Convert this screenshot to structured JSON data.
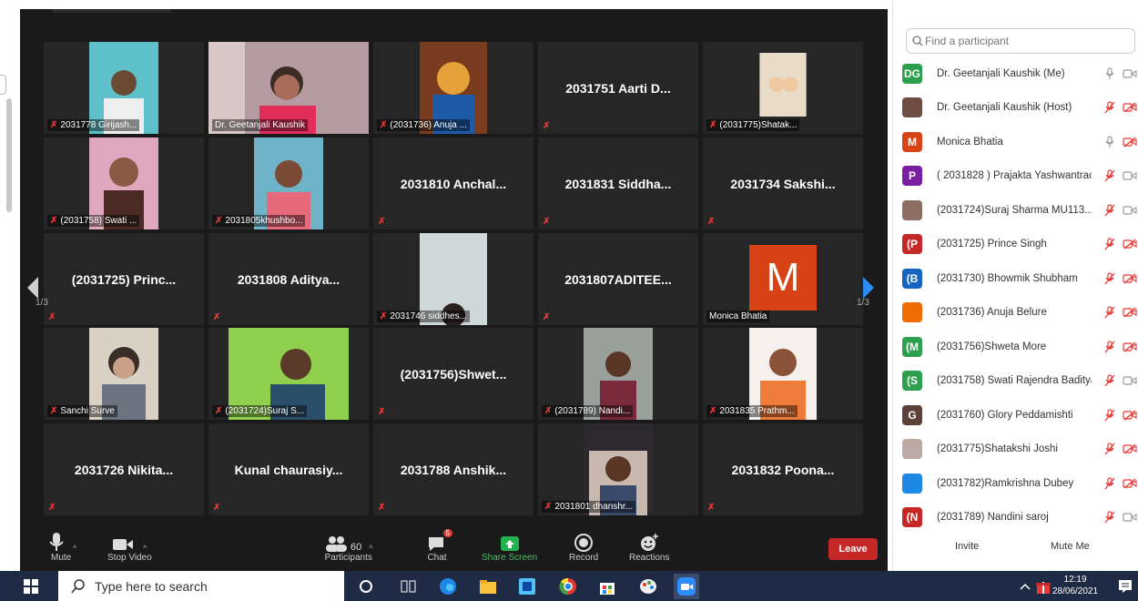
{
  "tiles": {
    "r1c1": "2031778 Girijash...",
    "r1c2": "Dr. Geetanjali Kaushik",
    "r1c3": "(2031736) Anuja ...",
    "r1c4": "2031751 Aarti D...",
    "r1c5": "(2031775)Shatak...",
    "r2c1": "(2031758) Swati ...",
    "r2c2": "2031805khushbo...",
    "r2c3": "2031810 Anchal...",
    "r2c4": "2031831 Siddha...",
    "r2c5": "2031734 Sakshi...",
    "r3c1": "(2031725) Princ...",
    "r3c2": "2031808 Aditya...",
    "r3c3": "2031746 siddhes...",
    "r3c4": "2031807ADITEE...",
    "r3c5": "Monica Bhatia",
    "r3c5_avatar": "M",
    "r4c1": "Sanchi Surve",
    "r4c2": "(2031724)Suraj S...",
    "r4c3": "(2031756)Shwet...",
    "r4c4": "(2031789) Nandi...",
    "r4c5": "2031835 Prathm...",
    "r5c1": "2031726 Nikita...",
    "r5c2": "Kunal  chaurasiy...",
    "r5c3": "2031788 Anshik...",
    "r5c4": "2031801 dhanshr...",
    "r5c5": "2031832 Poona..."
  },
  "pager": {
    "left": "1/3",
    "right": "1/3"
  },
  "toolbar": {
    "mute": "Mute",
    "stop_video": "Stop Video",
    "participants": "Participants",
    "participants_count": "60",
    "chat": "Chat",
    "chat_badge": "5",
    "share_screen": "Share Screen",
    "record": "Record",
    "reactions": "Reactions",
    "leave": "Leave"
  },
  "sidebar": {
    "search_placeholder": "Find a participant",
    "participants": [
      {
        "initials": "DG",
        "color": "#2e9e4f",
        "name": "Dr. Geetanjali Kaushik (Me)",
        "mic": "on",
        "video": "on"
      },
      {
        "initials": "",
        "color": "#6d4c41",
        "name": "Dr. Geetanjali Kaushik (Host)",
        "mic": "off",
        "video": "off"
      },
      {
        "initials": "M",
        "color": "#d84315",
        "name": "Monica Bhatia",
        "mic": "on",
        "video": "off"
      },
      {
        "initials": "P",
        "color": "#7b1fa2",
        "name": "( 2031828 ) Prajakta Yashwantrao",
        "mic": "off",
        "video": "on"
      },
      {
        "initials": "",
        "color": "#8d6e63",
        "name": "(2031724)Suraj Sharma MU113...",
        "mic": "off",
        "video": "on"
      },
      {
        "initials": "(P",
        "color": "#c62828",
        "name": "(2031725) Prince Singh",
        "mic": "off",
        "video": "off"
      },
      {
        "initials": "(B",
        "color": "#1565c0",
        "name": "(2031730) Bhowmik Shubham",
        "mic": "off",
        "video": "off"
      },
      {
        "initials": "",
        "color": "#ef6c00",
        "name": "(2031736) Anuja Belure",
        "mic": "off",
        "video": "off"
      },
      {
        "initials": "(M",
        "color": "#2e9e4f",
        "name": "(2031756)Shweta More",
        "mic": "off",
        "video": "off"
      },
      {
        "initials": "(S",
        "color": "#2e9e4f",
        "name": "(2031758) Swati Rajendra Baditya",
        "mic": "off",
        "video": "on"
      },
      {
        "initials": "G",
        "color": "#5d4037",
        "name": "(2031760) Glory Peddamishti",
        "mic": "off",
        "video": "off"
      },
      {
        "initials": "",
        "color": "#bcaaa4",
        "name": "(2031775)Shatakshi Joshi",
        "mic": "off",
        "video": "off"
      },
      {
        "initials": "",
        "color": "#1e88e5",
        "name": "(2031782)Ramkrishna Dubey",
        "mic": "off",
        "video": "off"
      },
      {
        "initials": "(N",
        "color": "#c62828",
        "name": "(2031789) Nandini saroj",
        "mic": "off",
        "video": "on"
      }
    ],
    "invite": "Invite",
    "mute_me": "Mute Me"
  },
  "taskbar": {
    "search": "Type here to search",
    "time": "12:19",
    "date": "28/06/2021"
  }
}
